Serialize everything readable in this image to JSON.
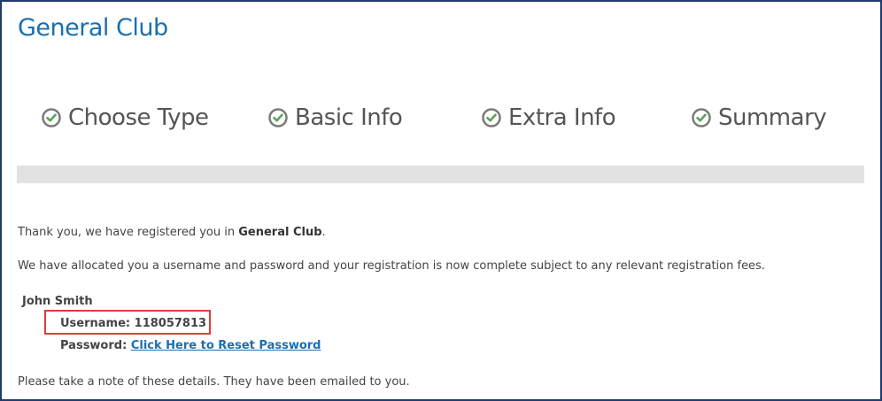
{
  "header": {
    "title": "General Club"
  },
  "steps": [
    {
      "label": "Choose Type",
      "icon": "check-circle-icon"
    },
    {
      "label": "Basic Info",
      "icon": "check-circle-icon"
    },
    {
      "label": "Extra Info",
      "icon": "check-circle-icon"
    },
    {
      "label": "Summary",
      "icon": "check-circle-icon"
    }
  ],
  "colors": {
    "accent": "#1a6fb0",
    "check": "#5aa35a",
    "highlight": "#e03a3a",
    "progress": "#e2e2e2"
  },
  "content": {
    "thanks_prefix": "Thank you, we have registered you in ",
    "thanks_club": "General Club",
    "thanks_suffix": ".",
    "allocated": "We have allocated you a username and password and your registration is now complete subject to any relevant registration fees.",
    "name": "John Smith",
    "username_label": "Username:",
    "username_value": "118057813",
    "password_label": "Password:",
    "password_link": "Click Here to Reset Password",
    "note": "Please take a note of these details. They have been emailed to you."
  }
}
